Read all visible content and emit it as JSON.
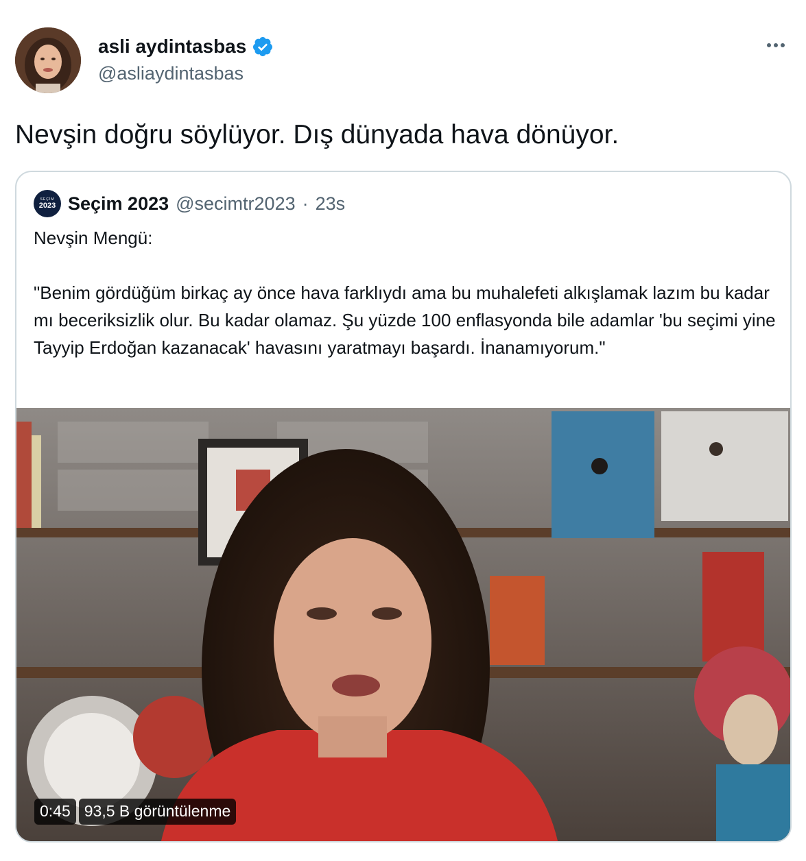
{
  "author": {
    "display_name": "asli aydintasbas",
    "handle": "@asliaydintasbas",
    "verified": true,
    "avatar_icon": "profile-photo"
  },
  "tweet": {
    "text": "Nevşin doğru söylüyor. Dış dünyada hava dönüyor."
  },
  "quoted": {
    "avatar_small": "SEÇİM",
    "avatar_big": "2023",
    "display_name": "Seçim 2023",
    "handle": "@secimtr2023",
    "separator": "·",
    "time": "23s",
    "text": "Nevşin Mengü:\n\n\"Benim gördüğüm birkaç ay önce hava farklıydı ama bu muhalefeti alkışlamak lazım bu kadar mı beceriksizlik olur. Bu kadar olamaz. Şu yüzde 100 enflasyonda bile adamlar 'bu seçimi yine Tayyip Erdoğan kazanacak' havasını yaratmayı başardı. İnanamıyorum.\"",
    "video": {
      "duration": "0:45",
      "views": "93,5 B görüntülenme"
    }
  },
  "colors": {
    "verified_blue": "#1d9bf0",
    "secondary_text": "#536471",
    "border": "#cfd9de"
  }
}
